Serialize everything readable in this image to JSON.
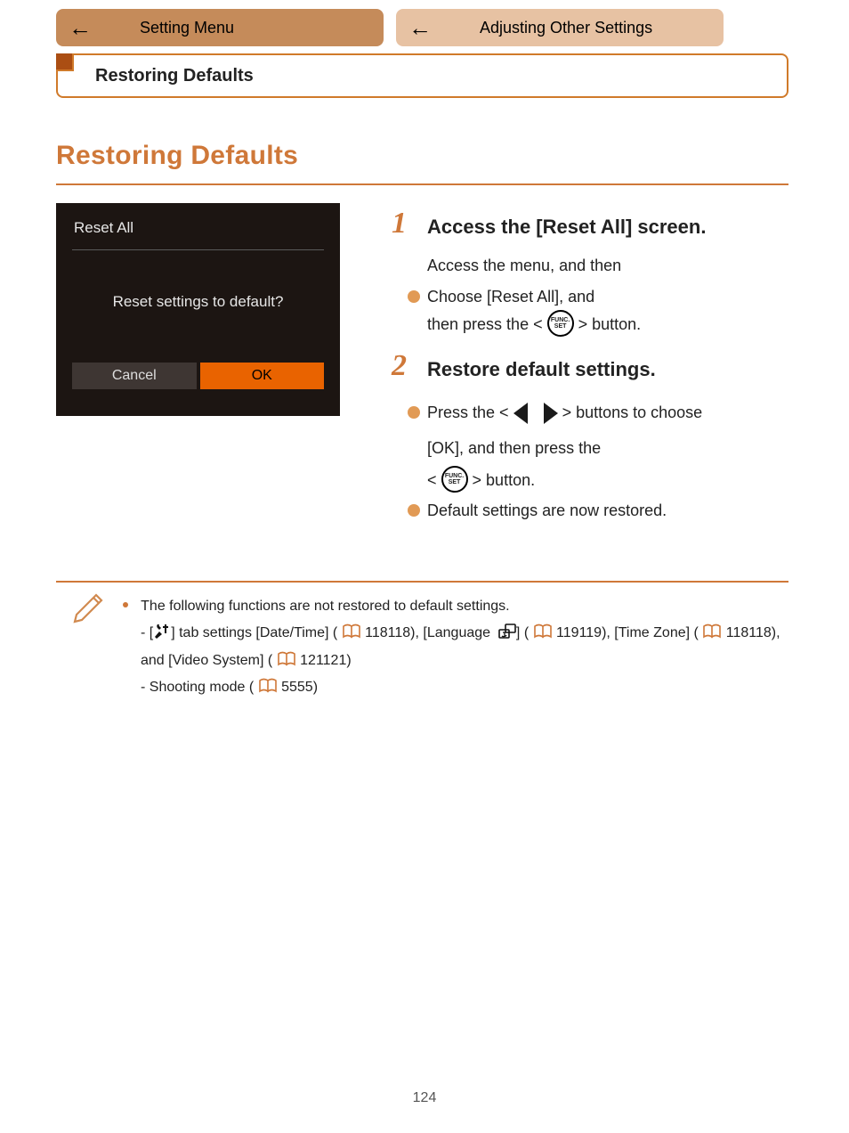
{
  "crumbs": {
    "left": {
      "label": "Setting Menu"
    },
    "right": {
      "label": "Adjusting Other Settings"
    }
  },
  "section_bar": {
    "title": "Restoring Defaults"
  },
  "heading": "Restoring Defaults",
  "lcd": {
    "title": "Reset All",
    "question": "Reset settings to default?",
    "cancel": "Cancel",
    "ok": "OK"
  },
  "steps": {
    "one": {
      "title": "Access the [Reset All] screen.",
      "line_a": "Access the menu, and then",
      "bullet1_a": "Choose [Reset All], and",
      "bullet1_b": "then press the <",
      "bullet1_c": "> button."
    },
    "two": {
      "title": "Restore default settings.",
      "bullet2_a": "Press the <",
      "bullet2_b": "><",
      "bullet2_c": "> buttons to choose",
      "bullet2_d": "[OK], and then press the",
      "bullet2_e": "< ",
      "bullet2_f": " > button.",
      "bullet3": "Default settings are now restored."
    }
  },
  "notes": {
    "intro": "The following functions are not restored to default settings.",
    "line1_a": "- [",
    "line1_b": "] tab settings [Date/Time] (",
    "line1_c": "118), [Language",
    "line1_d": "] (",
    "line1_e": "119), [Time Zone] (",
    "line1_f": "118), and [Video System] (",
    "line1_g": "121)",
    "line2_a": "- Shooting mode (",
    "line2_b": "55)",
    "ref_118": "118",
    "ref_119": "119",
    "ref_121": "121",
    "ref_55": "55"
  },
  "page_number": "124",
  "icons": {
    "func_set_top": "FUNC.",
    "func_set_bottom": "SET"
  }
}
